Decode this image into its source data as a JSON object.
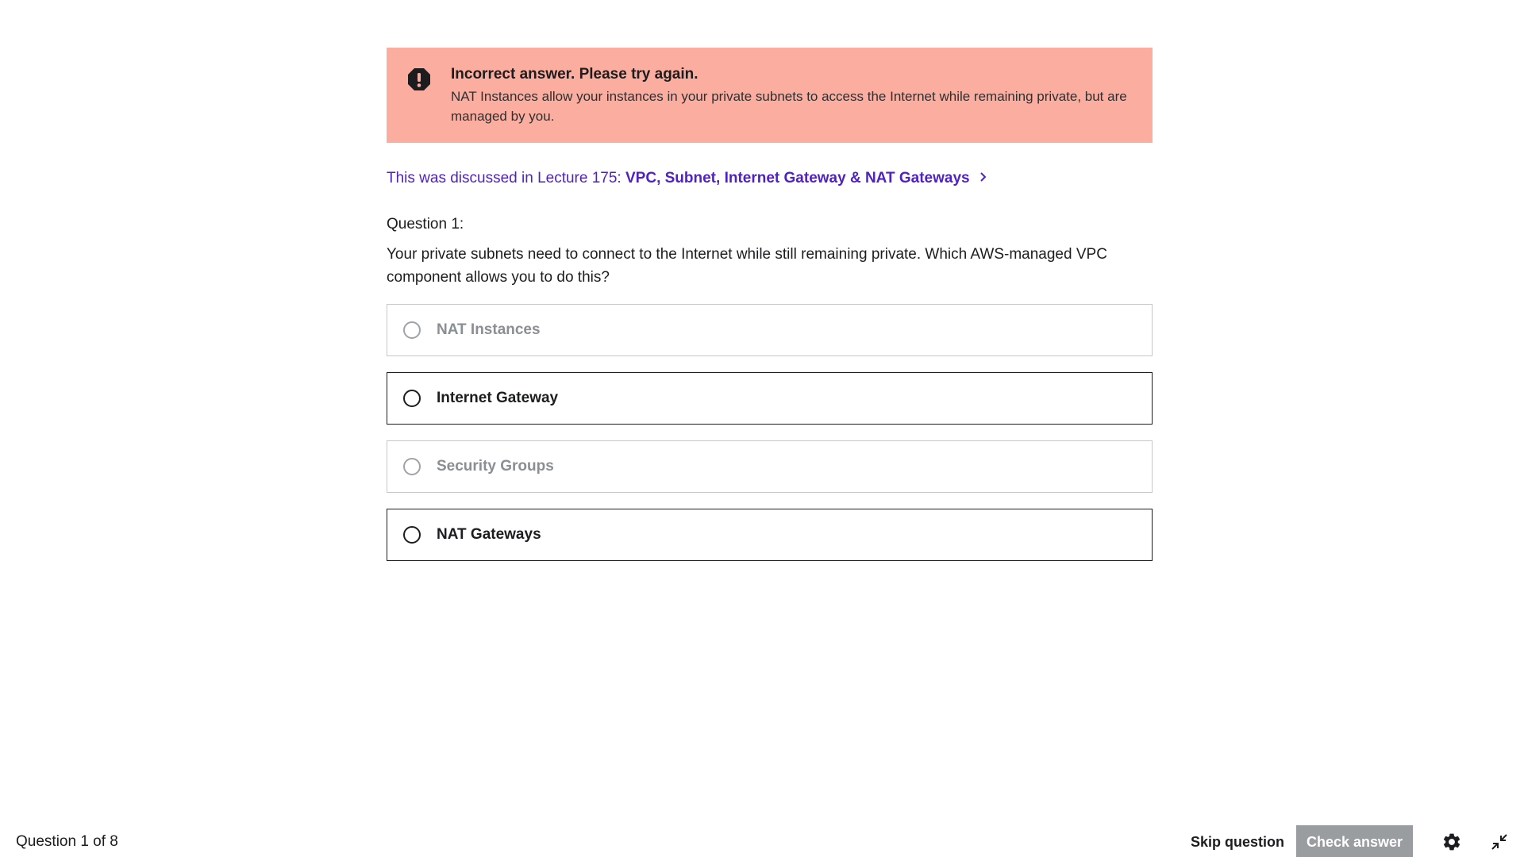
{
  "alert": {
    "icon": "error-octagon-icon",
    "title": "Incorrect answer. Please try again.",
    "body": "NAT Instances allow your instances in your private subnets to access the Internet while remaining private, but are managed by you.",
    "background_color": "#fbada0"
  },
  "lecture": {
    "prefix": "This was discussed in Lecture 175: ",
    "link_text": "VPC, Subnet, Internet Gateway & NAT Gateways",
    "link_color": "#5022c3",
    "chevron_icon": "chevron-right-icon"
  },
  "question": {
    "label": "Question 1:",
    "text": "Your private subnets need to connect to the Internet while still remaining private. Which AWS-managed VPC component allows you to do this?"
  },
  "options": [
    {
      "label": "NAT Instances",
      "state": "disabled"
    },
    {
      "label": "Internet Gateway",
      "state": "enabled"
    },
    {
      "label": "Security Groups",
      "state": "disabled"
    },
    {
      "label": "NAT Gateways",
      "state": "enabled"
    }
  ],
  "footer": {
    "progress": "Question 1 of 8",
    "skip_label": "Skip question",
    "check_label": "Check answer",
    "settings_icon": "gear-icon",
    "collapse_icon": "collapse-icon"
  }
}
